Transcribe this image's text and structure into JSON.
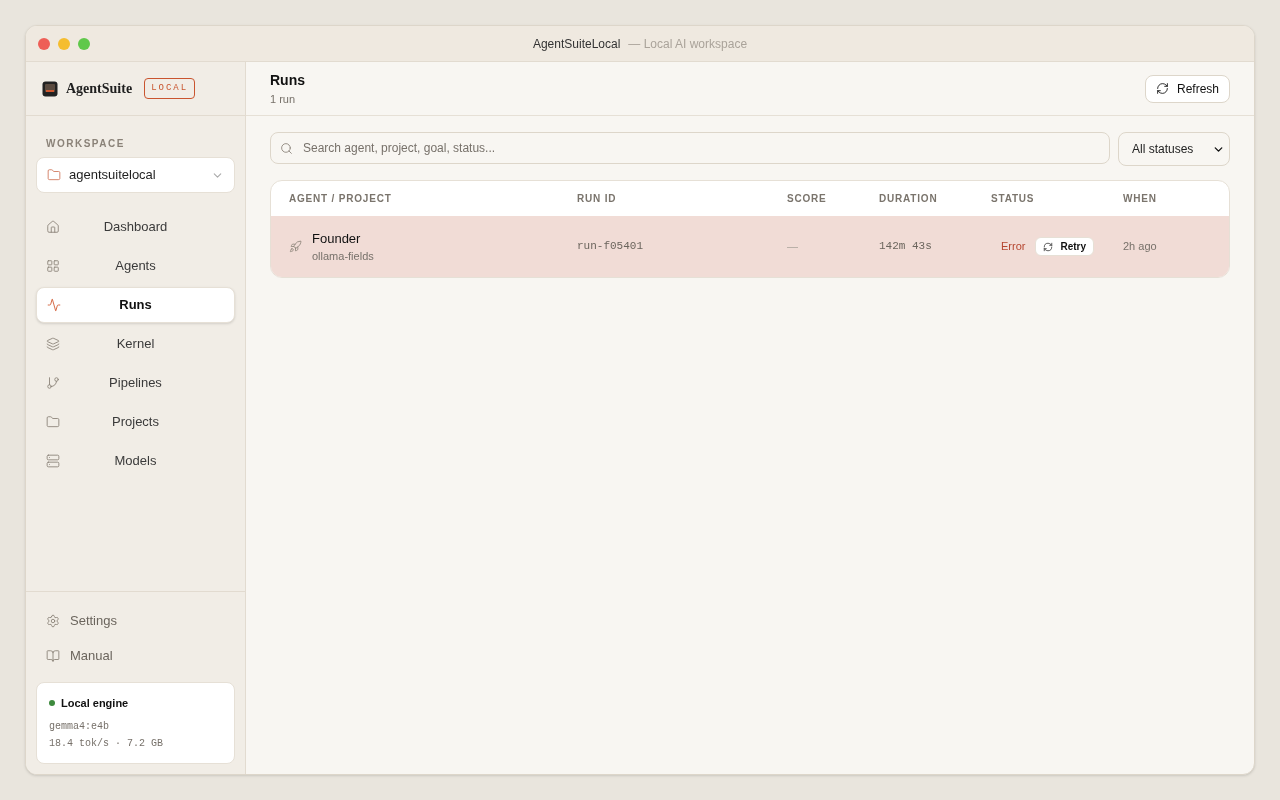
{
  "window": {
    "title": "AgentSuiteLocal",
    "subtitle": "— Local AI workspace"
  },
  "sidebar": {
    "brand": "AgentSuite",
    "badge": "LOCAL",
    "workspace_label": "WORKSPACE",
    "workspace": "agentsuitelocal",
    "items": [
      {
        "label": "Dashboard",
        "kind": "home",
        "selected": false
      },
      {
        "label": "Agents",
        "kind": "grid",
        "selected": false
      },
      {
        "label": "Runs",
        "kind": "activity",
        "selected": true
      },
      {
        "label": "Kernel",
        "kind": "layers",
        "selected": false
      },
      {
        "label": "Pipelines",
        "kind": "branch",
        "selected": false
      },
      {
        "label": "Projects",
        "kind": "folder",
        "selected": false
      },
      {
        "label": "Models",
        "kind": "server",
        "selected": false
      }
    ],
    "footer_items": [
      {
        "label": "Settings",
        "kind": "settings"
      },
      {
        "label": "Manual",
        "kind": "book"
      }
    ],
    "engine": {
      "title": "Local engine",
      "color": "#3d8a3d",
      "model": "gemma4:e4b",
      "stats": "18.4 tok/s · 7.2 GB"
    }
  },
  "header": {
    "title": "Runs",
    "subtitle": "1 run",
    "refresh": "Refresh"
  },
  "search": {
    "placeholder": "Search agent, project, goal, status..."
  },
  "filter": {
    "value": "All statuses"
  },
  "table": {
    "columns": [
      "AGENT / PROJECT",
      "RUN ID",
      "SCORE",
      "DURATION",
      "STATUS",
      "WHEN"
    ],
    "rows": [
      {
        "agent": "Founder",
        "project": "ollama-fields",
        "run_id": "run-f05401",
        "score": "—",
        "duration": "142m 43s",
        "status": "Error",
        "error": true,
        "retry": "Retry",
        "when": "2h ago"
      }
    ]
  }
}
